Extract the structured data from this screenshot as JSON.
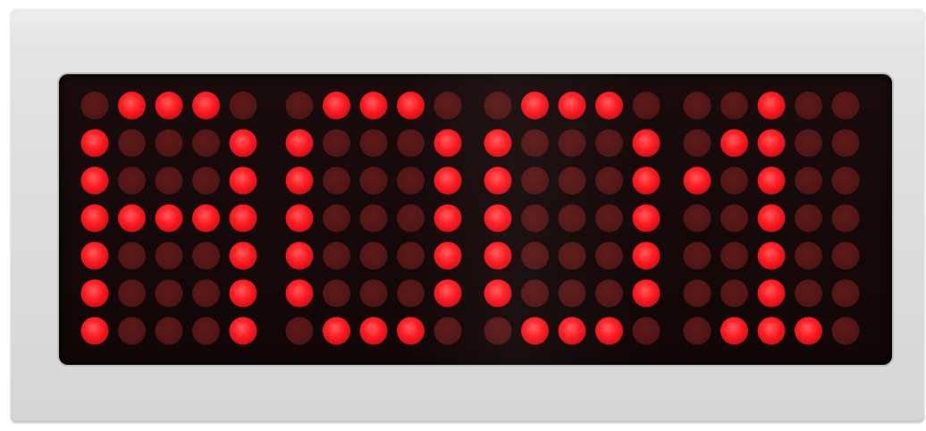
{
  "display": {
    "digits": [
      ".###.\n#...#\n#...#\n#####\n#...#\n#...#\n#...#",
      ".###.\n#...#\n#...#\n#...#\n#...#\n#...#\n.###.",
      ".###.\n#...#\n#...#\n#...#\n#...#\n#...#\n.###.",
      "..#..\n.##..\n#.#..\n..#..\n..#..\n..#..\n.###."
    ],
    "colors": {
      "led_on": "#ff1c22",
      "led_off": "#5a1616",
      "screen": "#140808",
      "housing": "#dcdcdc"
    }
  }
}
